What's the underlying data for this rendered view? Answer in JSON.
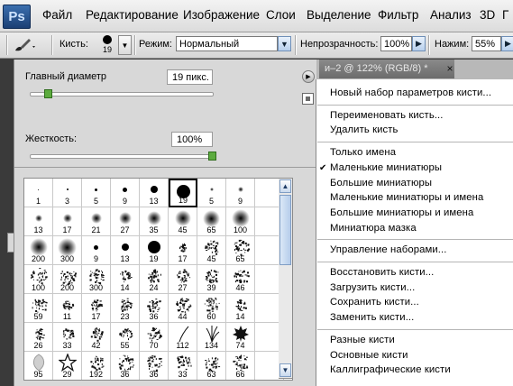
{
  "menubar": {
    "logo": "Ps",
    "items": [
      "Файл",
      "Редактирование",
      "Изображение",
      "Слои",
      "Выделение",
      "Фильтр",
      "Анализ",
      "3D",
      "Г"
    ]
  },
  "options": {
    "brush_label": "Кисть:",
    "brush_size": "19",
    "mode_label": "Режим:",
    "mode_value": "Нормальный",
    "opacity_label": "Непрозрачность:",
    "opacity_value": "100%",
    "flow_label": "Нажим:",
    "flow_value": "55%"
  },
  "document_tab": {
    "title": "и–2 @ 122% (RGB/8) *",
    "close": "×"
  },
  "brush_panel": {
    "diameter_label": "Главный диаметр",
    "diameter_value": "19 пикс.",
    "diameter_level": 0.1,
    "hardness_label": "Жесткость:",
    "hardness_value": "100%",
    "hardness_level": 1.0,
    "brushes": [
      {
        "label": "1",
        "kind": "hard",
        "size": 1
      },
      {
        "label": "3",
        "kind": "hard",
        "size": 2
      },
      {
        "label": "5",
        "kind": "hard",
        "size": 3
      },
      {
        "label": "9",
        "kind": "hard",
        "size": 5
      },
      {
        "label": "13",
        "kind": "hard",
        "size": 8
      },
      {
        "label": "19",
        "kind": "hard",
        "size": 15,
        "selected": true
      },
      {
        "label": "5",
        "kind": "soft",
        "size": 4
      },
      {
        "label": "9",
        "kind": "soft",
        "size": 6
      },
      {
        "label": "",
        "kind": "empty",
        "size": 0
      },
      {
        "label": "13",
        "kind": "soft",
        "size": 8
      },
      {
        "label": "17",
        "kind": "soft",
        "size": 10
      },
      {
        "label": "21",
        "kind": "soft",
        "size": 12
      },
      {
        "label": "27",
        "kind": "soft",
        "size": 14
      },
      {
        "label": "35",
        "kind": "soft",
        "size": 16
      },
      {
        "label": "45",
        "kind": "soft",
        "size": 18
      },
      {
        "label": "65",
        "kind": "soft",
        "size": 19
      },
      {
        "label": "100",
        "kind": "soft",
        "size": 20
      },
      {
        "label": "",
        "kind": "empty",
        "size": 0
      },
      {
        "label": "200",
        "kind": "soft",
        "size": 20
      },
      {
        "label": "300",
        "kind": "soft",
        "size": 21
      },
      {
        "label": "9",
        "kind": "hard",
        "size": 5
      },
      {
        "label": "13",
        "kind": "hard",
        "size": 8
      },
      {
        "label": "19",
        "kind": "hard",
        "size": 14
      },
      {
        "label": "17",
        "kind": "scatter",
        "size": 9
      },
      {
        "label": "45",
        "kind": "scatter",
        "size": 16
      },
      {
        "label": "65",
        "kind": "scatter",
        "size": 18
      },
      {
        "label": "",
        "kind": "empty",
        "size": 0
      },
      {
        "label": "100",
        "kind": "scatter",
        "size": 18
      },
      {
        "label": "200",
        "kind": "scatter",
        "size": 18
      },
      {
        "label": "300",
        "kind": "scatter",
        "size": 18
      },
      {
        "label": "14",
        "kind": "scatter",
        "size": 13
      },
      {
        "label": "24",
        "kind": "scatter",
        "size": 15
      },
      {
        "label": "27",
        "kind": "scatter",
        "size": 15
      },
      {
        "label": "39",
        "kind": "scatter",
        "size": 16
      },
      {
        "label": "46",
        "kind": "scatter",
        "size": 17
      },
      {
        "label": "",
        "kind": "empty",
        "size": 0
      },
      {
        "label": "59",
        "kind": "scatter",
        "size": 17
      },
      {
        "label": "11",
        "kind": "scatter",
        "size": 11
      },
      {
        "label": "17",
        "kind": "scatter",
        "size": 13
      },
      {
        "label": "23",
        "kind": "scatter",
        "size": 15
      },
      {
        "label": "36",
        "kind": "scatter",
        "size": 16
      },
      {
        "label": "44",
        "kind": "scatter",
        "size": 17
      },
      {
        "label": "60",
        "kind": "scatter",
        "size": 17
      },
      {
        "label": "14",
        "kind": "scatter",
        "size": 12
      },
      {
        "label": "",
        "kind": "empty",
        "size": 0
      },
      {
        "label": "26",
        "kind": "scatter",
        "size": 12
      },
      {
        "label": "33",
        "kind": "scatter",
        "size": 13
      },
      {
        "label": "42",
        "kind": "scatter",
        "size": 14
      },
      {
        "label": "55",
        "kind": "scatter",
        "size": 14
      },
      {
        "label": "70",
        "kind": "scatter",
        "size": 15
      },
      {
        "label": "112",
        "kind": "grass",
        "size": 18
      },
      {
        "label": "134",
        "kind": "grass",
        "size": 18
      },
      {
        "label": "74",
        "kind": "leaf",
        "size": 18
      },
      {
        "label": "",
        "kind": "empty",
        "size": 0
      },
      {
        "label": "95",
        "kind": "leafsoft",
        "size": 18
      },
      {
        "label": "29",
        "kind": "star",
        "size": 18
      },
      {
        "label": "192",
        "kind": "scatter",
        "size": 15
      },
      {
        "label": "36",
        "kind": "scatter",
        "size": 18
      },
      {
        "label": "36",
        "kind": "scatter",
        "size": 18
      },
      {
        "label": "33",
        "kind": "scatter",
        "size": 18
      },
      {
        "label": "63",
        "kind": "scatter",
        "size": 18
      },
      {
        "label": "66",
        "kind": "scatter",
        "size": 18
      },
      {
        "label": "",
        "kind": "empty",
        "size": 0
      }
    ]
  },
  "context_menu": {
    "groups": [
      [
        "Новый набор параметров кисти..."
      ],
      [
        "Переименовать кисть...",
        "Удалить кисть"
      ],
      [
        "Только имена",
        "Маленькие миниатюры",
        "Большие миниатюры",
        "Маленькие миниатюры и имена",
        "Большие миниатюры и имена",
        "Миниатюра мазка"
      ],
      [
        "Управление наборами..."
      ],
      [
        "Восстановить кисти...",
        "Загрузить кисти...",
        "Сохранить кисти...",
        "Заменить кисти..."
      ],
      [
        "Разные кисти",
        "Основные кисти",
        "Каллиграфические кисти"
      ]
    ],
    "checked": "Маленькие миниатюры",
    "check_glyph": "✔"
  }
}
